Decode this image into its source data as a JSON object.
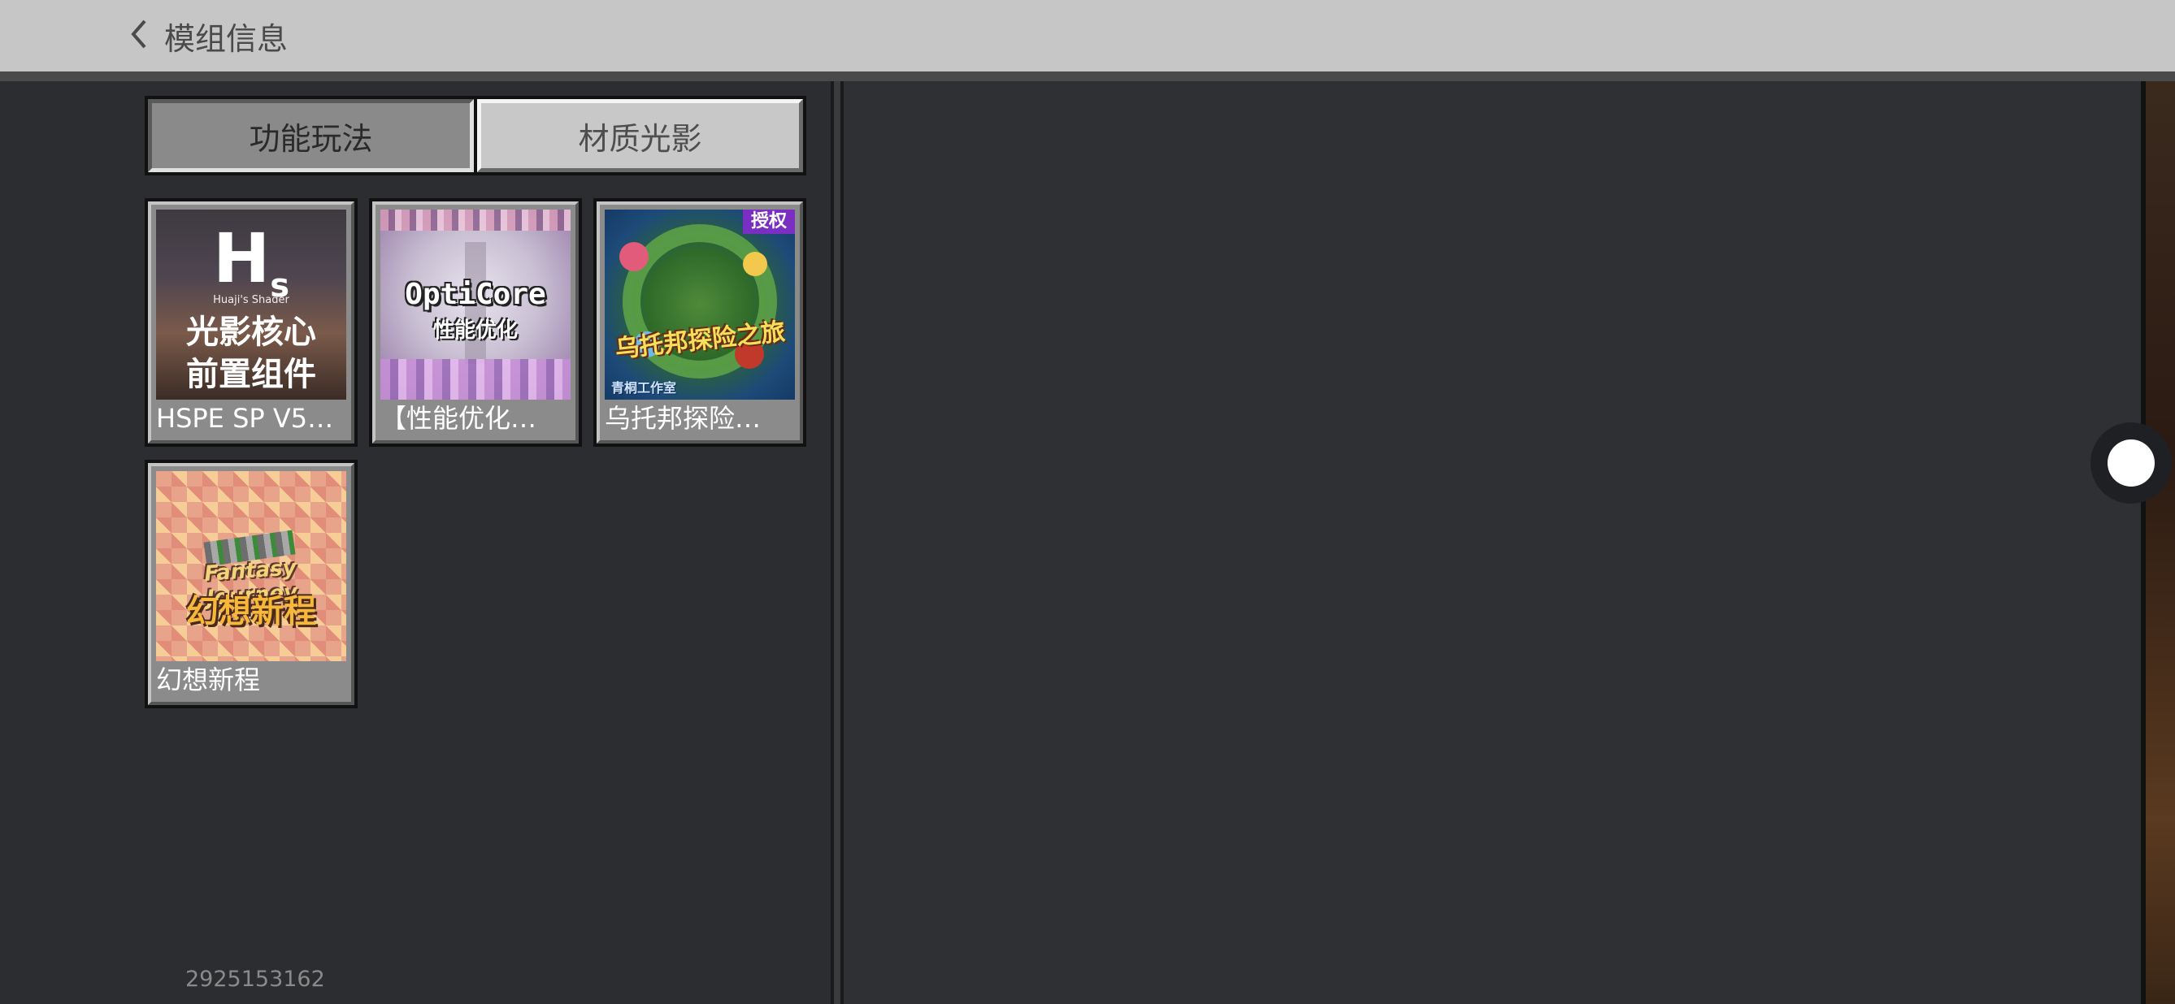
{
  "header": {
    "back_label": "模组信息"
  },
  "tabs": [
    {
      "label": "功能玩法",
      "selected": true
    },
    {
      "label": "材质光影",
      "selected": false
    }
  ],
  "mods": [
    {
      "label": "HSPE SP V5…",
      "thumb": {
        "line1": "H",
        "line1_sub": "s",
        "small": "Huaji's Shader",
        "line2": "光影核心",
        "line3": "前置组件"
      }
    },
    {
      "label": "【性能优化…",
      "thumb": {
        "logo": "OptiCore",
        "sub": "性能优化"
      }
    },
    {
      "label": "乌托邦探险…",
      "thumb": {
        "badge": "授权",
        "title": "乌托邦探险之旅",
        "studio": "青桐工作室"
      }
    },
    {
      "label": "幻想新程",
      "thumb": {
        "en": "Fantasy Journey",
        "cn": "幻想新程"
      }
    }
  ],
  "footer": {
    "user_id": "2925153162"
  },
  "colors": {
    "topbar": "#c6c6c6",
    "panel": "#2c2d30",
    "tab_active": "#8a8a8a",
    "tab_inactive": "#c8c8c8",
    "card_bg": "#8b8b8b",
    "badge": "#7a2fc2"
  },
  "icons": {
    "back": "chevron-left-icon",
    "scroll": "scroll-handle"
  }
}
